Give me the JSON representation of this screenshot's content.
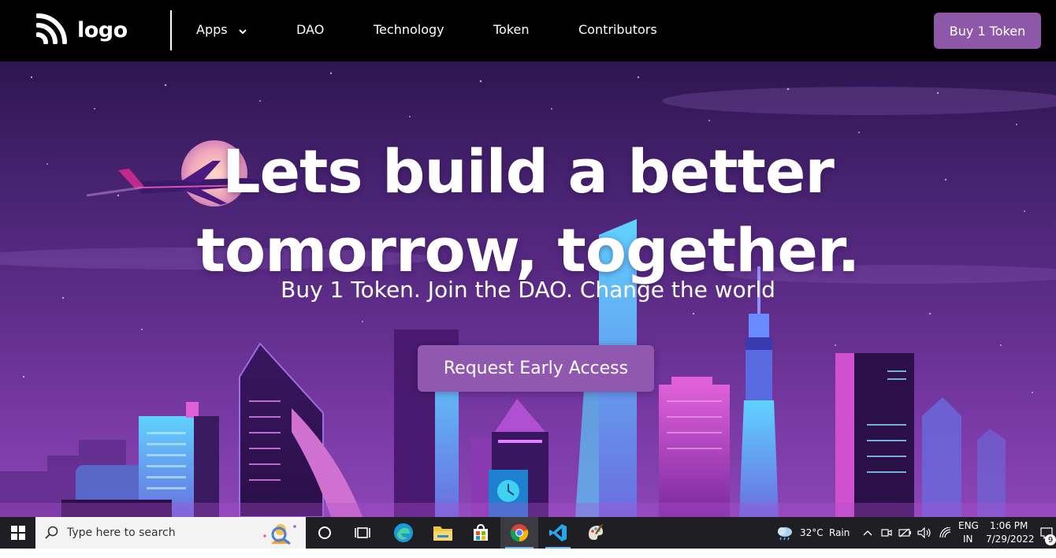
{
  "nav": {
    "logo_text": "logo",
    "links": [
      "Apps",
      "DAO",
      "Technology",
      "Token",
      "Contributors"
    ],
    "buy_button": "Buy 1 Token"
  },
  "hero": {
    "headline_line1": "Lets build a better",
    "headline_line2": "tomorrow, together.",
    "subheadline": "Buy 1 Token. Join the DAO. Change the world",
    "cta_button": "Request Early Access"
  },
  "taskbar": {
    "search_placeholder": "Type here to search",
    "apps": [
      "start-icon",
      "cortana-icon",
      "task-view-icon",
      "edge-icon",
      "file-explorer-icon",
      "store-icon",
      "chrome-icon",
      "vscode-icon",
      "paint-icon"
    ],
    "weather_temp": "32°C",
    "weather_desc": "Rain",
    "language_line1": "ENG",
    "language_line2": "IN",
    "time": "1:06 PM",
    "date": "7/29/2022",
    "notification_count": "9"
  },
  "colors": {
    "accent": "#8e58a8",
    "nav_bg": "#000000",
    "hero_top": "#2d1650",
    "hero_bottom": "#8a46b4"
  }
}
